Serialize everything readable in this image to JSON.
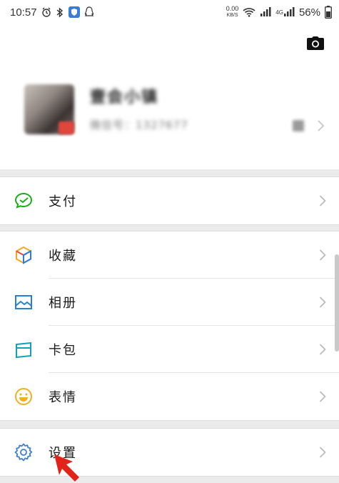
{
  "status_bar": {
    "time": "10:57",
    "net_speed_value": "0.00",
    "net_speed_unit": "KB/S",
    "signal_tag_1": "",
    "signal_tag_2": "4G",
    "battery": "56%"
  },
  "profile": {
    "nickname": "壹会小镇",
    "wechat_id": "微信号：1327677"
  },
  "menu": {
    "pay": "支付",
    "favorites": "收藏",
    "album": "相册",
    "cards": "卡包",
    "stickers": "表情",
    "settings": "设置"
  },
  "colors": {
    "pay_green": "#1aad19",
    "favorites_orange": "#f6a623",
    "album_blue": "#2a7fd4",
    "cards_teal": "#10a2b8",
    "stickers_yellow": "#f2b01e",
    "settings_blue": "#3d7fd1",
    "arrow_red": "#e2231a"
  }
}
